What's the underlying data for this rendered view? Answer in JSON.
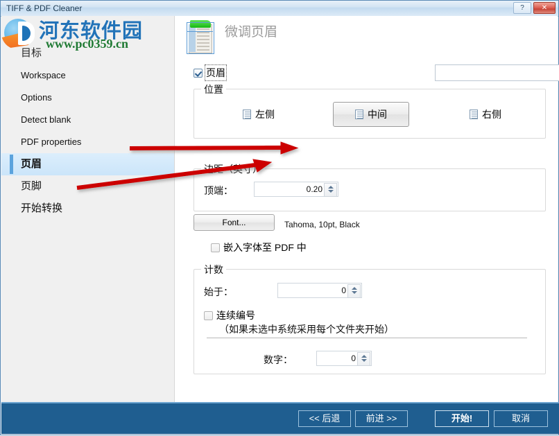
{
  "window": {
    "title": "TIFF & PDF Cleaner",
    "help_label": "?",
    "close_label": "✕"
  },
  "watermark": {
    "site_name": "河东软件园",
    "url": "www.pc0359.cn"
  },
  "sidebar": {
    "items": [
      {
        "label": "目标",
        "selected": false
      },
      {
        "label": "Workspace",
        "selected": false
      },
      {
        "label": "Options",
        "selected": false
      },
      {
        "label": "Detect blank",
        "selected": false
      },
      {
        "label": "PDF properties",
        "selected": false
      },
      {
        "label": "页眉",
        "selected": true
      },
      {
        "label": "页脚",
        "selected": false
      },
      {
        "label": "开始转换",
        "selected": false
      }
    ]
  },
  "main": {
    "page_title": "微调页眉",
    "icon_name": "document-header-icon",
    "header_checkbox": {
      "label": "页眉",
      "checked": true
    },
    "header_combo": {
      "value": "",
      "placeholder": ""
    },
    "position_group": {
      "legend": "位置",
      "options": [
        {
          "label": "左侧",
          "selected": false
        },
        {
          "label": "中间",
          "selected": true
        },
        {
          "label": "右侧",
          "selected": false
        }
      ]
    },
    "margin_group": {
      "legend": "边距（英寸）",
      "top_label": "顶端：",
      "top_value": "0.20"
    },
    "font_row": {
      "button_label": "Font...",
      "description": "Tahoma, 10pt, Black",
      "embed_label": "嵌入字体至 PDF 中",
      "embed_checked": false
    },
    "count_group": {
      "legend": "计数",
      "start_label": "始于：",
      "start_value": "0",
      "continuous_label": "连续编号",
      "continuous_checked": false,
      "continuous_hint": "（如果未选中系统采用每个文件夹开始）",
      "number_label": "数字：",
      "number_value": "0"
    }
  },
  "footer": {
    "back_label": "<< 后退",
    "next_label": "前进 >>",
    "start_label": "开始!",
    "cancel_label": "取消"
  },
  "colors": {
    "titlebar": "#c3daef",
    "footer_bar": "#1f5e90",
    "selection": "#cbe5fa",
    "close_button": "#c23d30",
    "annotation_arrow": "#cc0000"
  }
}
